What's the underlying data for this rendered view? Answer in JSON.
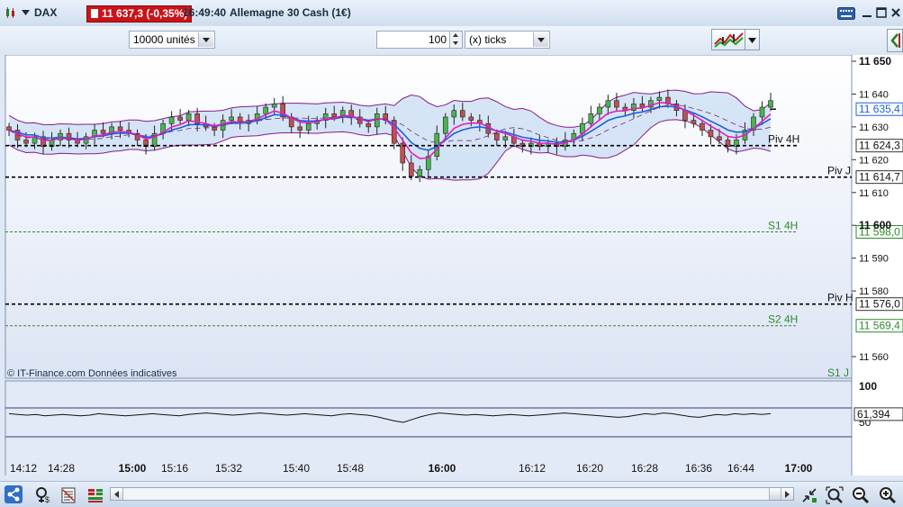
{
  "titlebar": {
    "ticker": "DAX",
    "price_badge": "11 637,3 (-0,35%)",
    "time": "16:49:40",
    "instrument": "Allemagne 30 Cash (1€)"
  },
  "toolbar": {
    "quantity_value": "10000 unités",
    "ticks_value": "100",
    "ticks_unit": "(x) ticks"
  },
  "colors": {
    "up_candle": "#4db34d",
    "down_candle": "#c24f4f",
    "bollinger": "#8a1a8a",
    "ma_fast": "#e020c0",
    "ma_slow": "#1f5fd8",
    "pivot_line": "#000000",
    "support_line": "#2e8b2e",
    "price_badge": "#c8141a"
  },
  "chart_data": {
    "type": "candlestick",
    "ylim": [
      11553,
      11651
    ],
    "y_ticks": [
      "11 650",
      "11 640",
      "11 630",
      "11 620",
      "11 610",
      "11 600",
      "11 590",
      "11 580",
      "11 560"
    ],
    "x_ticks": [
      "14:12",
      "14:28",
      "15:00",
      "15:16",
      "15:32",
      "15:40",
      "15:48",
      "16:00",
      "16:12",
      "16:20",
      "16:28",
      "16:36",
      "16:44",
      "17:00"
    ],
    "current_price": "11 635,4",
    "levels": [
      {
        "label": "Piv 4H",
        "value": 11624.3,
        "price_label": "11 624,3",
        "style": "pivot"
      },
      {
        "label": "Piv J",
        "value": 11614.7,
        "price_label": "11 614,7",
        "style": "pivot"
      },
      {
        "label": "S1 4H",
        "value": 11598.0,
        "price_label": "11 598,0",
        "style": "support"
      },
      {
        "label": "Piv H",
        "value": 11576.0,
        "price_label": "11 576,0",
        "style": "pivot"
      },
      {
        "label": "S2 4H",
        "value": 11569.4,
        "price_label": "11 569,4",
        "style": "support"
      },
      {
        "label": "S1 J",
        "value": 11552.0,
        "price_label": "",
        "style": "support"
      }
    ],
    "close_path": [
      11629,
      11626,
      11625,
      11627,
      11624,
      11626,
      11628,
      11626,
      11625,
      11627,
      11629,
      11628,
      11630,
      11629,
      11628,
      11626,
      11624,
      11628,
      11631,
      11633,
      11632,
      11634,
      11631,
      11630,
      11629,
      11632,
      11633,
      11631,
      11632,
      11634,
      11636,
      11637,
      11633,
      11630,
      11629,
      11631,
      11632,
      11634,
      11633,
      11635,
      11633,
      11631,
      11630,
      11634,
      11632,
      11625,
      11619,
      11615,
      11617,
      11621,
      11628,
      11633,
      11635,
      11633,
      11632,
      11631,
      11628,
      11626,
      11627,
      11625,
      11624,
      11625,
      11624,
      11625,
      11624,
      11626,
      11628,
      11631,
      11634,
      11636,
      11638,
      11636,
      11635,
      11637,
      11636,
      11638,
      11639,
      11637,
      11635,
      11632,
      11631,
      11629,
      11627,
      11626,
      11624,
      11626,
      11629,
      11633,
      11636,
      11638
    ],
    "watermark": "© IT-Finance.com  Données indicatives",
    "oscillator": {
      "type": "line",
      "ylim": [
        30,
        100
      ],
      "y_ticks": [
        "100",
        "50"
      ],
      "current_value": "61,394",
      "upper_band": 70,
      "lower_band": 30,
      "values": [
        62,
        61,
        60,
        61,
        59,
        60,
        61,
        60,
        59,
        60,
        62,
        61,
        60,
        59,
        60,
        61,
        62,
        61,
        60,
        59,
        61,
        62,
        63,
        62,
        61,
        60,
        61,
        62,
        63,
        62,
        61,
        60,
        61,
        62,
        61,
        60,
        59,
        61,
        62,
        61,
        60,
        58,
        55,
        52,
        50,
        54,
        58,
        61,
        63,
        62,
        61,
        60,
        61,
        60,
        59,
        60,
        61,
        60,
        59,
        60,
        61,
        62,
        63,
        62,
        61,
        60,
        59,
        58,
        57,
        58,
        60,
        62,
        61,
        63,
        62,
        60,
        58,
        57,
        59,
        61,
        60,
        62,
        61,
        62,
        61,
        62
      ]
    }
  }
}
